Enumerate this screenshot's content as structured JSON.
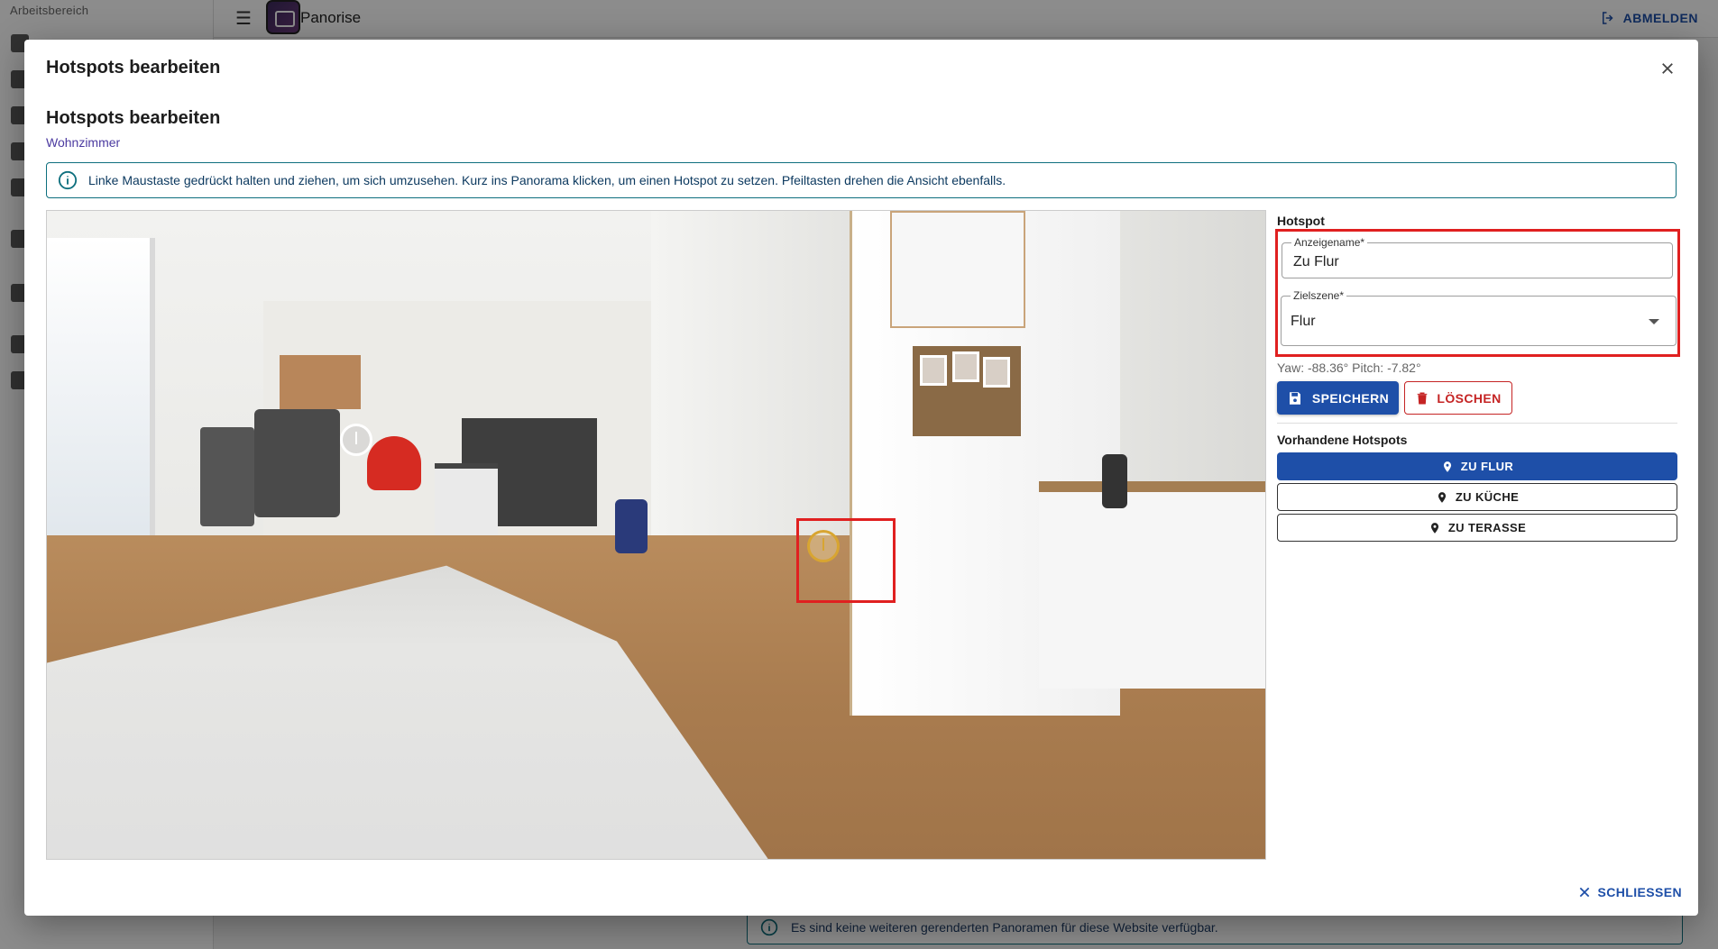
{
  "background": {
    "sidebar": {
      "workspace_label": "Arbeitsbereich"
    },
    "topbar": {
      "brand": "Panorise",
      "logout_label": "ABMELDEN"
    },
    "info_text": "Es sind keine weiteren gerenderten Panoramen für diese Website verfügbar."
  },
  "dialog": {
    "title": "Hotspots bearbeiten",
    "section_title": "Hotspots bearbeiten",
    "scene_name": "Wohnzimmer",
    "info": "Linke Maustaste gedrückt halten und ziehen, um sich umzusehen. Kurz ins Panorama klicken, um einen Hotspot zu setzen. Pfeiltasten drehen die Ansicht ebenfalls.",
    "panel": {
      "label": "Hotspot",
      "name_field": {
        "label": "Anzeigename*",
        "value": "Zu Flur"
      },
      "target_field": {
        "label": "Zielszene*",
        "value": "Flur"
      },
      "coords": "Yaw: -88.36°  Pitch: -7.82°",
      "save_label": "SPEICHERN",
      "delete_label": "LÖSCHEN",
      "existing_label": "Vorhandene Hotspots",
      "hotspots": [
        {
          "label": "ZU FLUR"
        },
        {
          "label": "ZU KÜCHE"
        },
        {
          "label": "ZU TERASSE"
        }
      ]
    },
    "close_label": "SCHLIESSEN"
  },
  "colors": {
    "primary": "#1e4fa8",
    "danger": "#c52424",
    "highlight": "#e02020",
    "active_hotspot": "#d8a531"
  }
}
